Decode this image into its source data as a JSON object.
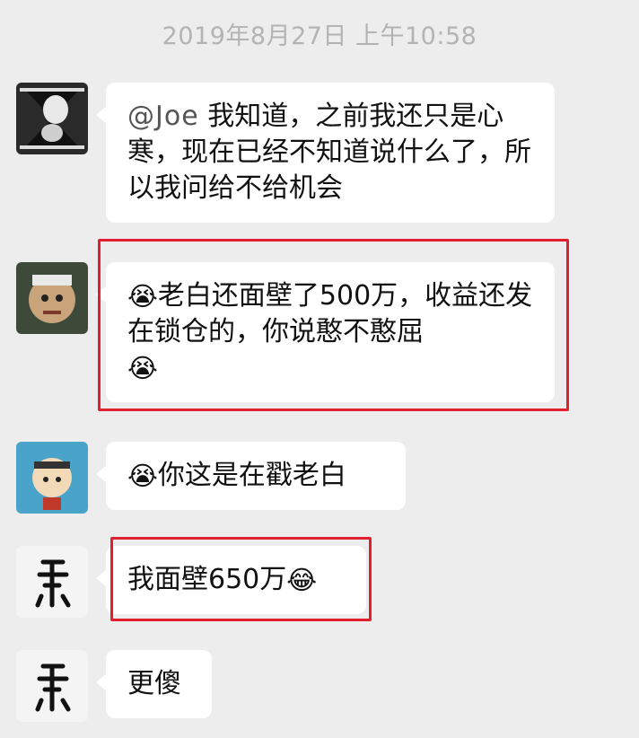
{
  "chat": {
    "timestamp": "2019年8月27日 上午10:58",
    "messages": [
      {
        "sender_avatar": "avatar-photo-1",
        "mention": "@Joe",
        "text": "我知道，之前我还只是心寒，现在已经不知道说什么了，所以我问给不给机会",
        "highlighted": false
      },
      {
        "sender_avatar": "avatar-cartoon-2",
        "emoji": "😭",
        "text": "老白还面壁了500万，收益还发在锁仓的，你说憨不憨屈",
        "trailing_emoji": "😭",
        "highlighted": true
      },
      {
        "sender_avatar": "avatar-cartoon-3",
        "emoji": "😭",
        "text": "你这是在戳老白",
        "highlighted": false
      },
      {
        "sender_avatar": "avatar-calligraphy",
        "text": "我面壁650万",
        "trailing_emoji": "😂",
        "highlighted": true
      },
      {
        "sender_avatar": "avatar-calligraphy",
        "text": "更傻",
        "highlighted": false
      }
    ]
  },
  "colors": {
    "background": "#ededed",
    "bubble": "#ffffff",
    "highlight": "#e0202e",
    "timestamp": "#b3b3b3"
  }
}
